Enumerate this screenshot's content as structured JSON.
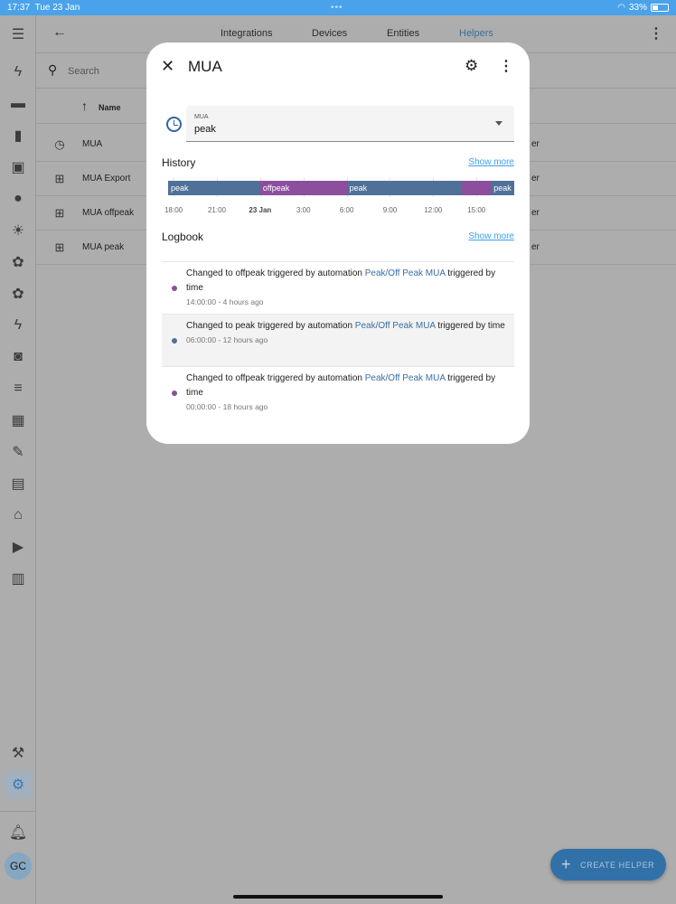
{
  "status_bar": {
    "time": "17:37",
    "date": "Tue 23 Jan",
    "battery": "33%"
  },
  "sidebar": {
    "avatar": "GC"
  },
  "topbar": {
    "tabs": [
      {
        "label": "Integrations"
      },
      {
        "label": "Devices"
      },
      {
        "label": "Entities"
      },
      {
        "label": "Helpers",
        "active": true
      }
    ]
  },
  "search": {
    "placeholder": "Search"
  },
  "table": {
    "column": "Name",
    "rows": [
      {
        "name": "MUA",
        "icon": "clock-icon",
        "tail": "er"
      },
      {
        "name": "MUA Export",
        "icon": "counter-icon",
        "tail": "er"
      },
      {
        "name": "MUA offpeak",
        "icon": "counter-icon",
        "tail": "er"
      },
      {
        "name": "MUA peak",
        "icon": "counter-icon",
        "tail": "er"
      }
    ]
  },
  "fab": {
    "label": "CREATE HELPER"
  },
  "dialog": {
    "title": "MUA",
    "select": {
      "label": "MUA",
      "value": "peak"
    },
    "history": {
      "title": "History",
      "show_more": "Show more",
      "range_hours": 24,
      "start_offset_hours": -0.383,
      "colors": {
        "peak": "#4f7198",
        "offpeak": "#8c4f9d"
      },
      "segments": [
        {
          "state": "peak",
          "label": "peak",
          "from": 0,
          "to": 6.383
        },
        {
          "state": "offpeak",
          "label": "offpeak",
          "from": 6.383,
          "to": 12.383
        },
        {
          "state": "peak",
          "label": "peak",
          "from": 12.383,
          "to": 20.383
        },
        {
          "state": "offpeak",
          "label": "",
          "from": 20.383,
          "to": 22.383
        },
        {
          "state": "peak",
          "label": "peak",
          "from": 22.383,
          "to": 24
        }
      ],
      "ticks": [
        {
          "label": "18:00",
          "h": 0.383
        },
        {
          "label": "21:00",
          "h": 3.383
        },
        {
          "label": "23 Jan",
          "h": 6.383,
          "bold": true
        },
        {
          "label": "3:00",
          "h": 9.383
        },
        {
          "label": "6:00",
          "h": 12.383
        },
        {
          "label": "9:00",
          "h": 15.383
        },
        {
          "label": "12:00",
          "h": 18.383
        },
        {
          "label": "15:00",
          "h": 21.383
        }
      ]
    },
    "logbook": {
      "title": "Logbook",
      "show_more": "Show more",
      "entries": [
        {
          "pre": "Changed to offpeak triggered by automation ",
          "link": "Peak/Off Peak MUA",
          "post": " triggered by time",
          "time": "14:00:00 - 4 hours ago",
          "color": "#8c4f9d"
        },
        {
          "pre": "Changed to peak triggered by automation ",
          "link": "Peak/Off Peak MUA",
          "post": " triggered by time",
          "time": "06:00:00 - 12 hours ago",
          "color": "#4f7198"
        },
        {
          "pre": "Changed to offpeak triggered by automation ",
          "link": "Peak/Off Peak MUA",
          "post": " triggered by time",
          "time": "00:00:00 - 18 hours ago",
          "color": "#8c4f9d"
        }
      ]
    }
  }
}
